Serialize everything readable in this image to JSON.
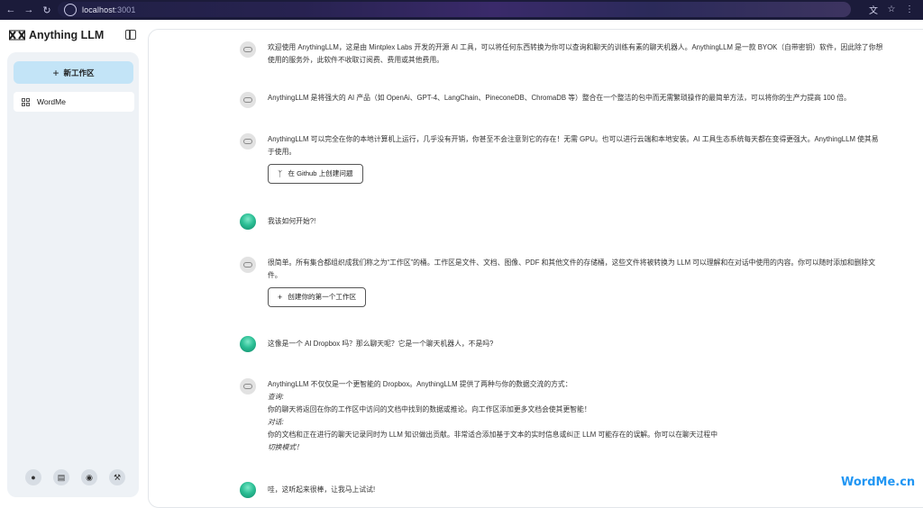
{
  "browser": {
    "back_icon": "arrow-left-icon",
    "forward_icon": "arrow-right-icon",
    "reload_icon": "reload-icon",
    "url_host": "localhost",
    "url_port": ":3001"
  },
  "brand": {
    "name": "Anything LLM"
  },
  "sidebar": {
    "new_workspace_label": "新工作区",
    "workspaces": [
      {
        "label": "WordMe"
      }
    ],
    "footer_icons": [
      "github-icon",
      "docs-icon",
      "discord-icon",
      "settings-icon"
    ]
  },
  "messages": [
    {
      "role": "bot",
      "text": "欢迎使用 AnythingLLM，这是由 Mintplex Labs 开发的开源 AI 工具，可以将任何东西转换为你可以查询和聊天的训练有素的聊天机器人。AnythingLLM 是一款 BYOK（自带密钥）软件，因此除了你想使用的服务外，此软件不收取订阅费、费用或其他费用。"
    },
    {
      "role": "bot",
      "text": "AnythingLLM 是将强大的 AI 产品（如 OpenAi、GPT-4、LangChain、PineconeDB、ChromaDB 等）整合在一个整洁的包中而无需繁琐操作的最简单方法，可以将你的生产力提高 100 倍。"
    },
    {
      "role": "bot",
      "text": "AnythingLLM 可以完全在你的本地计算机上运行，几乎没有开销，你甚至不会注意到它的存在！无需 GPU。也可以进行云端和本地安装。AI 工具生态系统每天都在变得更强大。AnythingLLM 使其易于使用。",
      "button": "在 Github 上创建问题"
    },
    {
      "role": "user",
      "text": "我该如何开始?!"
    },
    {
      "role": "bot",
      "text": "很简单。所有集合都组织成我们称之为“工作区”的桶。工作区是文件、文档、图像、PDF 和其他文件的存储桶，这些文件将被转换为 LLM 可以理解和在对话中使用的内容。你可以随时添加和删除文件。",
      "button": "创建你的第一个工作区"
    },
    {
      "role": "user",
      "text": "这像是一个 AI Dropbox 吗？那么聊天呢？它是一个聊天机器人，不是吗?"
    },
    {
      "role": "bot",
      "lines": [
        "AnythingLLM 不仅仅是一个更智能的 Dropbox。AnythingLLM 提供了两种与你的数据交流的方式：",
        "查询:",
        "你的聊天将返回在你的工作区中访问的文档中找到的数据或推论。向工作区添加更多文档会使其更智能！",
        "对话:",
        "你的文档和正在进行的聊天记录同时为 LLM 知识做出贡献。非常适合添加基于文本的实时信息或纠正 LLM 可能存在的误解。你可以在聊天过程中",
        "切换模式！"
      ]
    },
    {
      "role": "user",
      "text": "哇，这听起来很棒，让我马上试试!"
    }
  ],
  "watermark": "WordMe.cn"
}
